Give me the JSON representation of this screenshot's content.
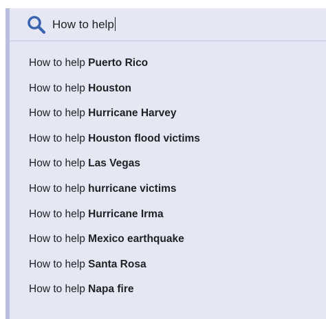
{
  "search": {
    "query": "How to help",
    "icon": "search-icon",
    "icon_color": "#3c64b1"
  },
  "suggestions": [
    {
      "prefix": "How to help",
      "completion": "Puerto Rico"
    },
    {
      "prefix": "How to help",
      "completion": "Houston"
    },
    {
      "prefix": "How to help",
      "completion": "Hurricane Harvey"
    },
    {
      "prefix": "How to help",
      "completion": "Houston flood victims"
    },
    {
      "prefix": "How to help",
      "completion": "Las Vegas"
    },
    {
      "prefix": "How to help",
      "completion": "hurricane victims"
    },
    {
      "prefix": "How to help",
      "completion": "Hurricane Irma"
    },
    {
      "prefix": "How to help",
      "completion": "Mexico earthquake"
    },
    {
      "prefix": "How to help",
      "completion": "Santa Rosa"
    },
    {
      "prefix": "How to help",
      "completion": "Napa fire"
    }
  ],
  "colors": {
    "panel_background": "#e5e7f4",
    "accent_border": "#b9bede",
    "text": "#202124"
  }
}
